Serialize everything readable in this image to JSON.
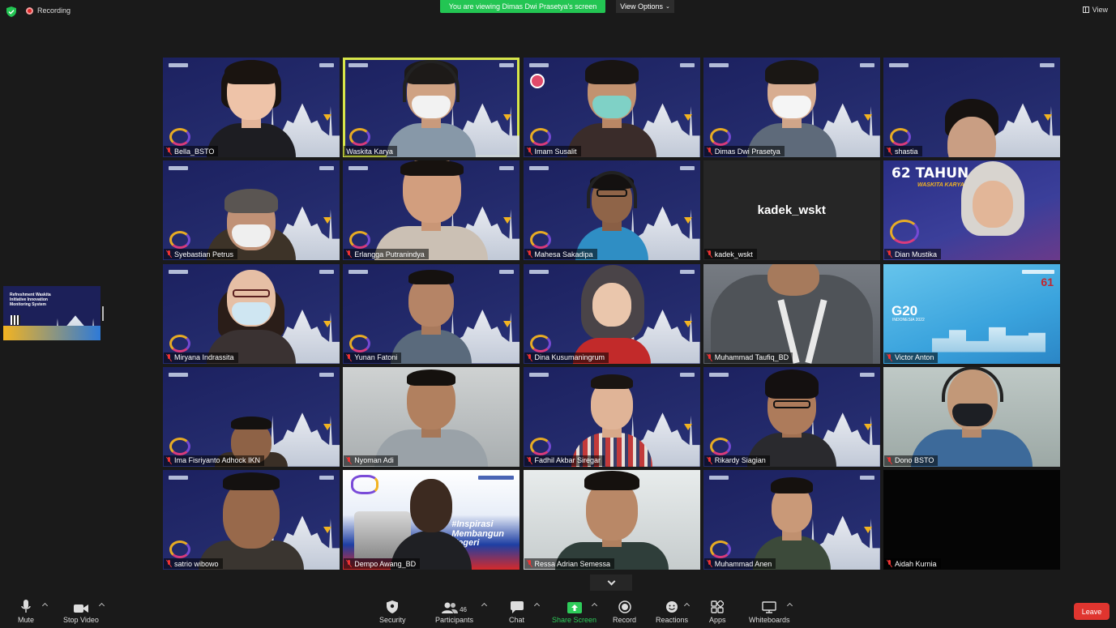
{
  "topbar": {
    "recording_label": "Recording",
    "viewing_banner": "You are viewing Dimas Dwi Prasetya's screen",
    "view_options_label": "View Options",
    "view_label": "View"
  },
  "share_thumb": {
    "title": "Refreshment Waskita Initiative Innovation Monitoring System"
  },
  "participants": [
    {
      "name": "Bella_BSTO"
    },
    {
      "name": "Waskita Karya"
    },
    {
      "name": "Imam Susalit"
    },
    {
      "name": "Dimas Dwi Prasetya"
    },
    {
      "name": "shastia"
    },
    {
      "name": "Syebastian Petrus"
    },
    {
      "name": "Erlangga Putranindya"
    },
    {
      "name": "Mahesa Sakadipa"
    },
    {
      "name": "kadek_wskt",
      "display_text": "kadek_wskt"
    },
    {
      "name": "Dian Mustika",
      "bg_text": "62 TAHUN",
      "bg_sub": "WASKITA KARYA"
    },
    {
      "name": "Miryana Indrassita"
    },
    {
      "name": "Yunan Fatoni"
    },
    {
      "name": "Dina Kusumaningrum"
    },
    {
      "name": "Muhammad Taufiq_BD"
    },
    {
      "name": "Victor Anton",
      "bg_text": "G20",
      "bg_sub": "INDONESIA 2022",
      "bg_badge": "61"
    },
    {
      "name": "Ima Fisriyanto Adhock IKN"
    },
    {
      "name": "Nyoman Adi"
    },
    {
      "name": "Fadhil Akbar Siregar"
    },
    {
      "name": "Rikardy Siagian"
    },
    {
      "name": "Dono BSTO"
    },
    {
      "name": "satrio wibowo"
    },
    {
      "name": "Dempo Awang_BD",
      "bg_text": "#Inspirasi Membangun Negeri"
    },
    {
      "name": "Ressa Adrian Semessa"
    },
    {
      "name": "Muhammad Anen"
    },
    {
      "name": "Aidah Kurnia"
    }
  ],
  "toolbar": {
    "mute": "Mute",
    "stop_video": "Stop Video",
    "security": "Security",
    "participants": "Participants",
    "participants_count": "46",
    "chat": "Chat",
    "share_screen": "Share Screen",
    "record": "Record",
    "reactions": "Reactions",
    "apps": "Apps",
    "whiteboards": "Whiteboards",
    "leave": "Leave"
  },
  "colors": {
    "active_speaker_border": "#d7e64a",
    "banner_green": "#23c553",
    "leave_red": "#e0352f",
    "share_green": "#2ecc5a"
  }
}
